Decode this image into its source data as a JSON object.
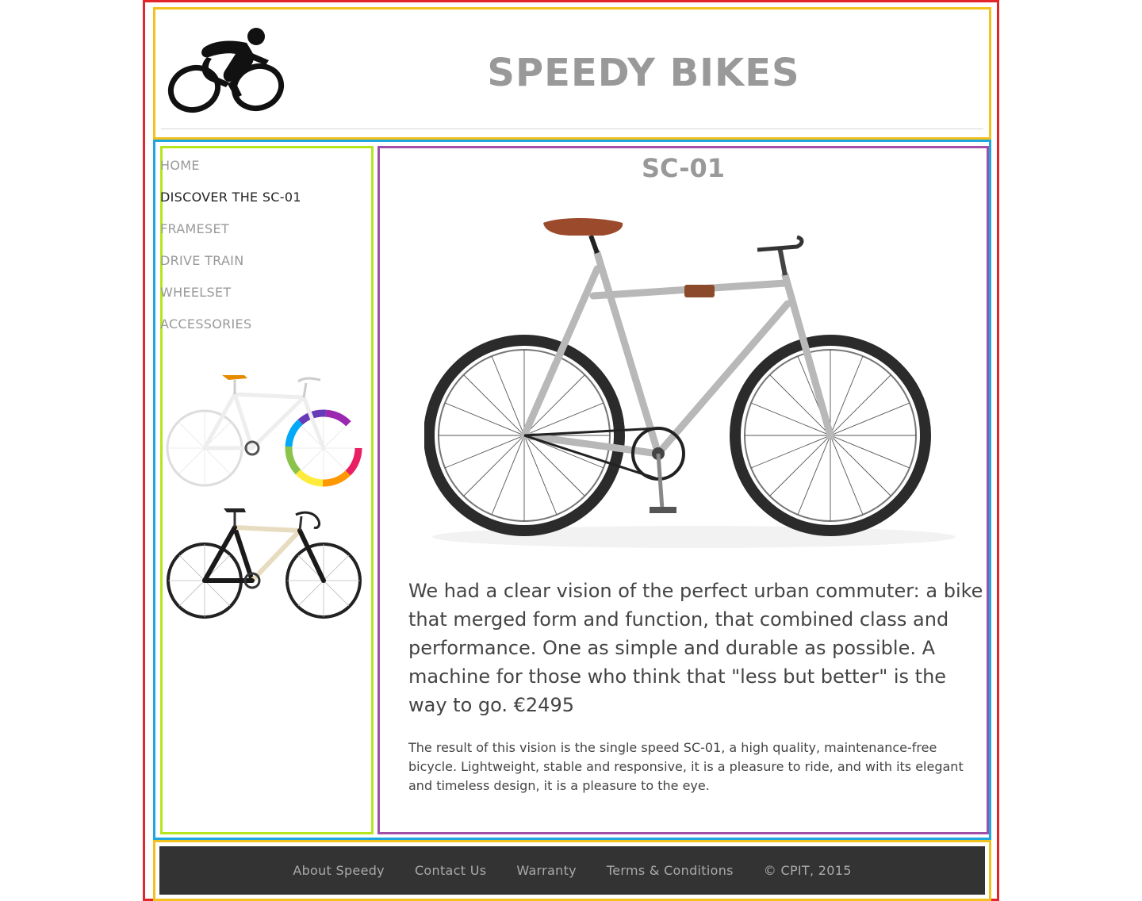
{
  "header": {
    "logo_icon": "cyclist-logo-icon",
    "title": "SPEEDY BIKES"
  },
  "nav": {
    "items": [
      {
        "label": "HOME",
        "active": false
      },
      {
        "label": "DISCOVER THE SC-01",
        "active": true
      },
      {
        "label": "FRAMESET",
        "active": false
      },
      {
        "label": "DRIVE TRAIN",
        "active": false
      },
      {
        "label": "WHEELSET",
        "active": false
      },
      {
        "label": "ACCESSORIES",
        "active": false
      }
    ]
  },
  "sidebar": {
    "thumbnails": [
      "white-rainbow-fixie-image",
      "black-cream-track-bike-image"
    ]
  },
  "main": {
    "title": "SC-01",
    "hero_image": "silver-single-speed-bike-image",
    "lead": "We had a clear vision of the perfect urban commuter: a bike that merged form and function, that combined class and performance. One as simple and durable as possible. A machine for those who think that \"less but better\" is the way to go. €2495",
    "body": "The result of this vision is the single speed SC-01, a high quality, maintenance-free bicycle. Lightweight, stable and responsive, it is a pleasure to ride, and with its elegant and timeless design, it is a pleasure to the eye."
  },
  "footer": {
    "links": [
      "About Speedy",
      "Contact Us",
      "Warranty",
      "Terms & Conditions"
    ],
    "copyright": "© CPIT, 2015"
  },
  "colors": {
    "outer_border": "#e3242b",
    "header_border": "#f2c11d",
    "content_border": "#1ea6df",
    "sidebar_border": "#b5e61d",
    "main_border": "#a14ea9",
    "footer_bg": "#333333",
    "title_gray": "#999999"
  }
}
